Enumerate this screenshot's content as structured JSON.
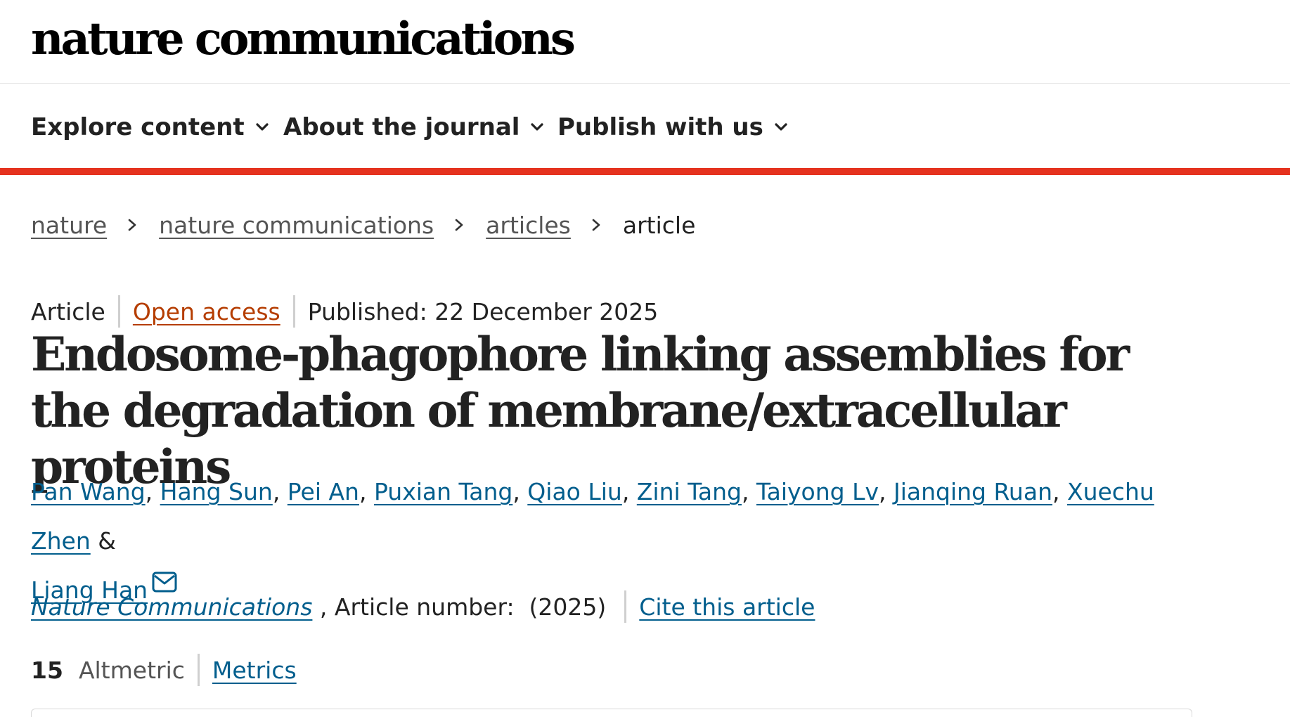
{
  "site": {
    "logo_text": "nature communications"
  },
  "nav": {
    "items": [
      {
        "label": "Explore content"
      },
      {
        "label": "About the journal"
      },
      {
        "label": "Publish with us"
      }
    ],
    "accent_color": "#e5321f"
  },
  "breadcrumb": {
    "items": [
      {
        "label": "nature"
      },
      {
        "label": "nature communications"
      },
      {
        "label": "articles"
      }
    ],
    "current": "article"
  },
  "article": {
    "type": "Article",
    "access": "Open access",
    "published": "Published: 22 December 2025",
    "title": "Endosome-phagophore linking assemblies for the degradation of membrane/extracellular proteins",
    "authors": [
      "Pan Wang",
      "Hang Sun",
      "Pei An",
      "Puxian Tang",
      "Qiao Liu",
      "Zini Tang",
      "Taiyong Lv",
      "Jianqing Ruan",
      "Xuechu Zhen"
    ],
    "last_author": "Liang Han",
    "author_separator": ", ",
    "author_ampersand": " & ",
    "corresponding_icon": "mail-icon",
    "journal": "Nature Communications",
    "article_number_text": " , Article number:  (2025)",
    "cite_label": "Cite this article",
    "altmetric_count": "15",
    "altmetric_label": "Altmetric",
    "metrics_label": "Metrics"
  },
  "colors": {
    "link_blue": "#025e8d",
    "open_access_orange": "#b53d00",
    "text": "#222222",
    "muted": "#555555"
  },
  "icons": {
    "nav_chevron": "chevron-down-icon",
    "breadcrumb_separator": "chevron-right-icon"
  }
}
